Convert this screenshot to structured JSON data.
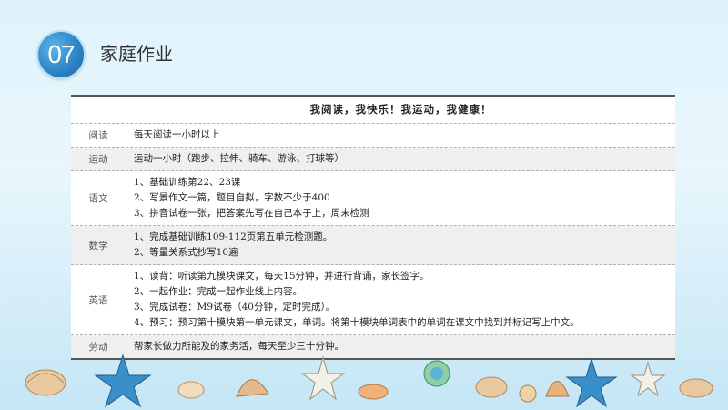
{
  "section": {
    "number": "07",
    "title": "家庭作业"
  },
  "table": {
    "header": "我阅读，我快乐！我运动，我健康！",
    "rows": [
      {
        "label": "阅读",
        "lines": [
          "每天阅读一小时以上"
        ]
      },
      {
        "label": "运动",
        "lines": [
          "运动一小时（跑步、拉伸、骑车、游泳、打球等）"
        ]
      },
      {
        "label": "语文",
        "lines": [
          "1、基础训练第22、23课",
          "2、写景作文一篇，题目自拟，字数不少于400",
          "3、拼音试卷一张，把答案先写在自己本子上，周末检测"
        ]
      },
      {
        "label": "数学",
        "lines": [
          "1、完成基础训练109-112页第五单元检测题。",
          "2、等量关系式抄写10遍"
        ]
      },
      {
        "label": "英语",
        "lines": [
          "1、读背：听读第九模块课文，每天15分钟，并进行背诵，家长签字。",
          "2、一起作业：完成一起作业线上内容。",
          "3、完成试卷：M9试卷（40分钟，定时完成）。",
          "4、预习：预习第十模块第一单元课文，单词。将第十模块单词表中的单词在课文中找到并标记写上中文。"
        ]
      },
      {
        "label": "劳动",
        "lines": [
          "帮家长做力所能及的家务活，每天至少三十分钟。"
        ]
      }
    ]
  },
  "colors": {
    "badge": "#2f86c9",
    "header_rule": "#555555",
    "shaded_row": "#efefef"
  },
  "decorations": [
    "seashell-icon",
    "starfish-icon",
    "sea-urchin-icon",
    "snail-shell-icon"
  ]
}
